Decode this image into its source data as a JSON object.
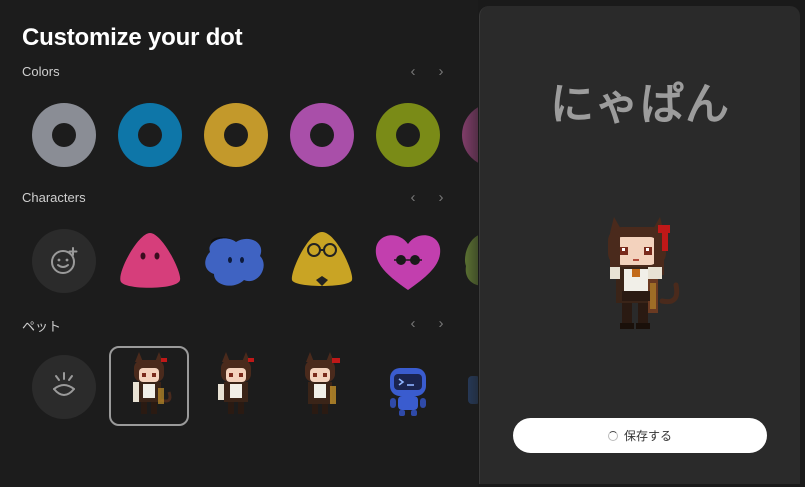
{
  "header": {
    "title": "Customize your dot"
  },
  "sections": {
    "colors": {
      "label": "Colors"
    },
    "characters": {
      "label": "Characters"
    },
    "pets": {
      "label": "ペット"
    }
  },
  "colors": [
    "#8a8d95",
    "#0e76a8",
    "#c3992b",
    "#a94fa9",
    "#7a8b17",
    "#a84a88"
  ],
  "characters": [
    {
      "name": "add-character",
      "icon": "smiley-plus-icon"
    },
    {
      "name": "pink-blob",
      "color": "#d63e7b"
    },
    {
      "name": "blue-blob",
      "color": "#3f63c2"
    },
    {
      "name": "yellow-blob",
      "color": "#c9a424"
    },
    {
      "name": "magenta-heart",
      "color": "#c23fae"
    },
    {
      "name": "green-blob",
      "color": "#7a9b3c"
    }
  ],
  "pets": [
    {
      "name": "add-pet",
      "icon": "sparkle-face-icon"
    },
    {
      "name": "cat-girl-1",
      "selected": true
    },
    {
      "name": "cat-girl-2"
    },
    {
      "name": "cat-girl-3"
    },
    {
      "name": "blue-robot"
    }
  ],
  "preview": {
    "name": "にゃぱん",
    "save_label": "保存する"
  }
}
